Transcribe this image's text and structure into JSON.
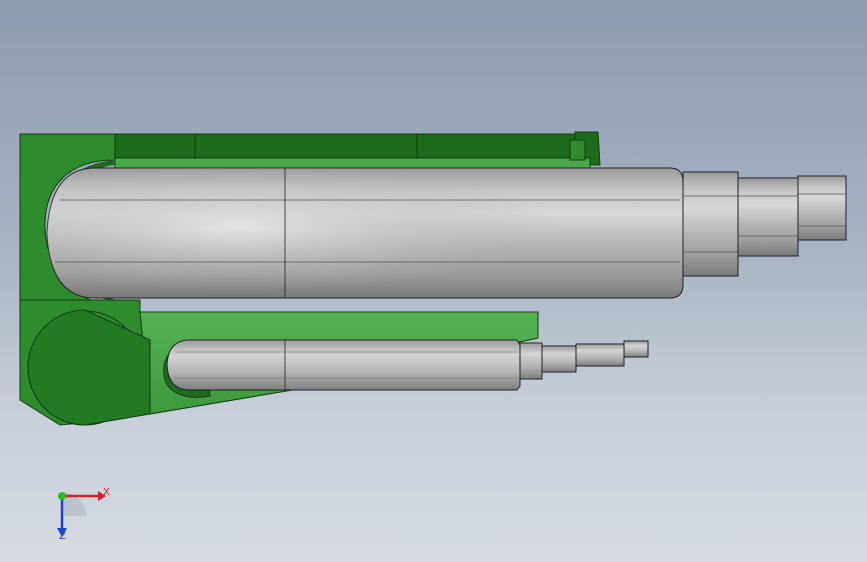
{
  "viewport": {
    "background_top": "#8d9bb0",
    "background_bottom": "#d6dbe2"
  },
  "model": {
    "holder_color": "#2e8b2e",
    "holder_dark": "#1e6b1e",
    "holder_light": "#4aa84a",
    "tool_color": "#b9b9b9",
    "tool_highlight": "#dcdcdc",
    "tool_shadow": "#8a8a8a"
  },
  "triad": {
    "x_label": "X",
    "z_label": "Z",
    "x_color": "#d0202a",
    "y_color": "#1fbf1f",
    "z_color": "#2040d0"
  }
}
